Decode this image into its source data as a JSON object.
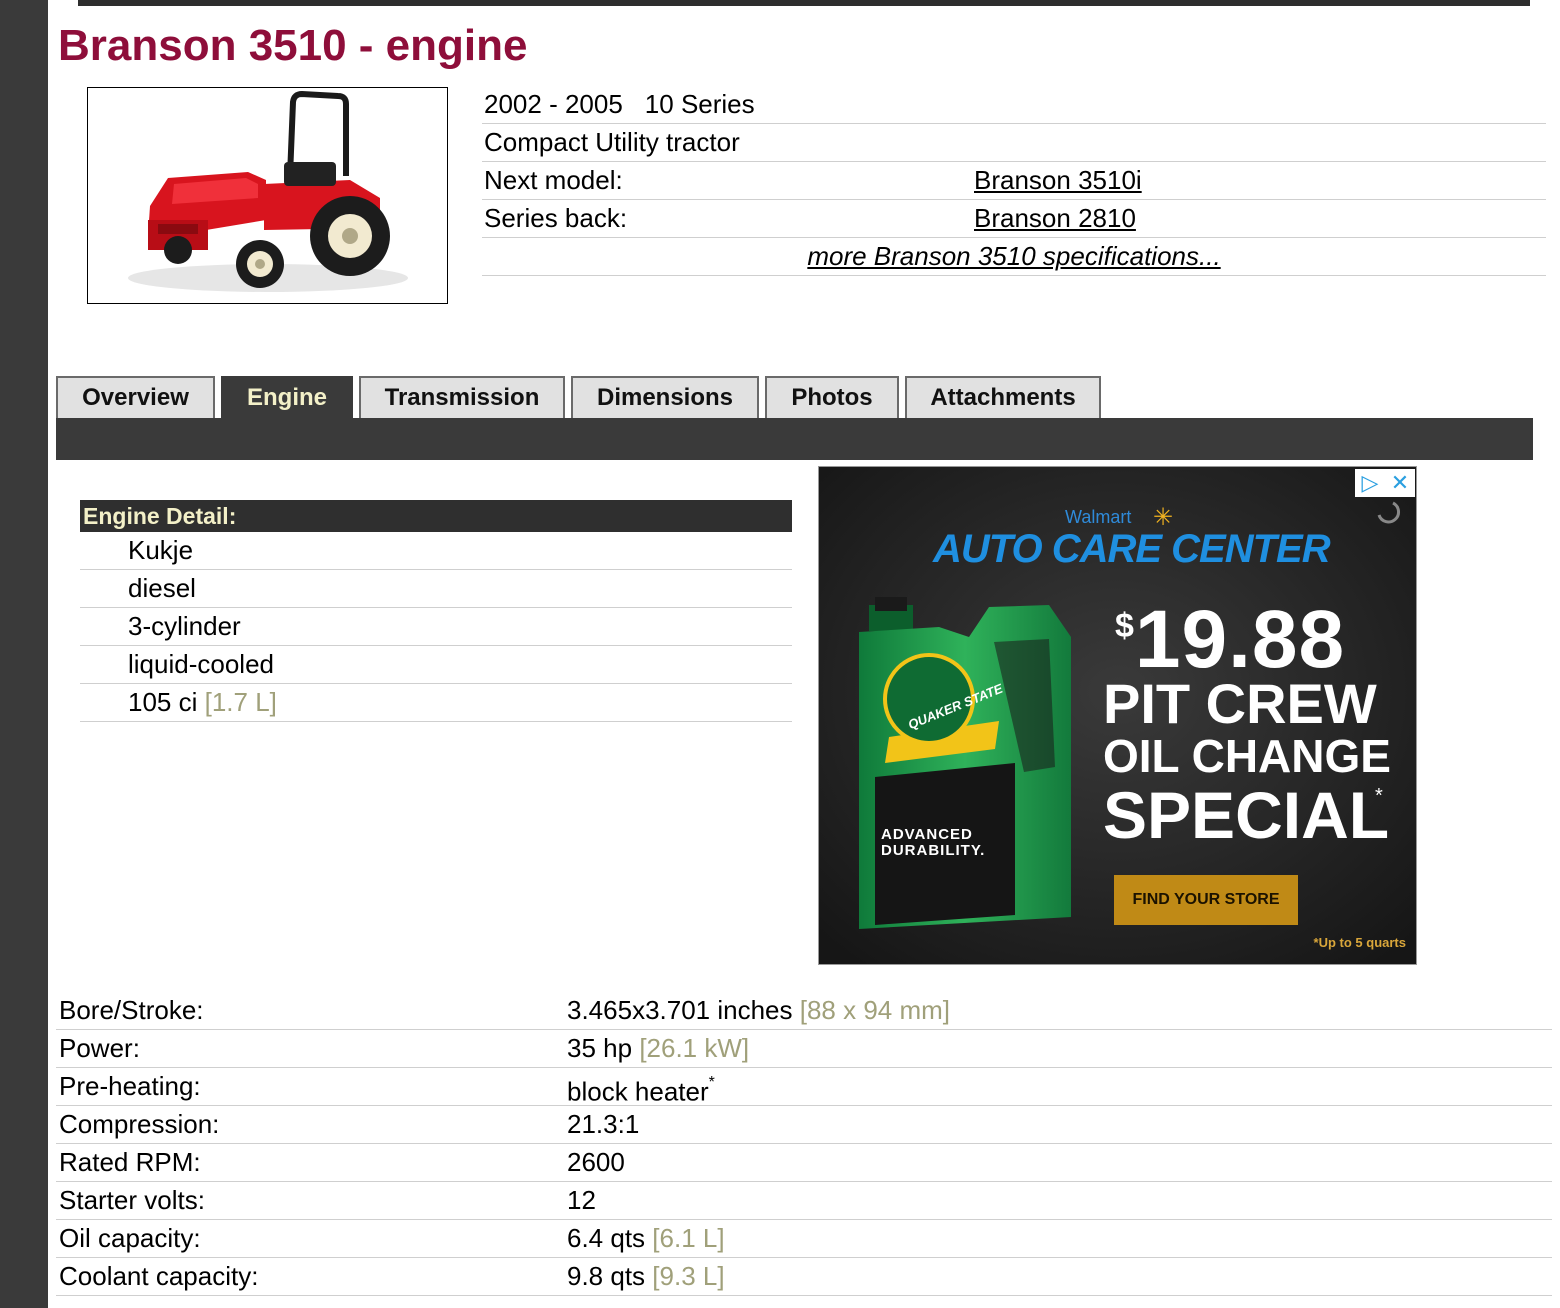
{
  "page": {
    "title": "Branson 3510 - engine"
  },
  "summary": {
    "years": "2002 - 2005",
    "series": "10 Series",
    "type": "Compact Utility tractor",
    "next_model_label": "Next model:",
    "next_model_value": "Branson 3510i",
    "series_back_label": "Series back:",
    "series_back_value": "Branson 2810",
    "more_link": "more Branson 3510 specifications..."
  },
  "tabs": [
    {
      "label": "Overview",
      "active": false
    },
    {
      "label": "Engine",
      "active": true
    },
    {
      "label": "Transmission",
      "active": false
    },
    {
      "label": "Dimensions",
      "active": false
    },
    {
      "label": "Photos",
      "active": false
    },
    {
      "label": "Attachments",
      "active": false
    }
  ],
  "engine_detail": {
    "heading": "Engine Detail:",
    "manufacturer": "Kukje",
    "fuel": "diesel",
    "cylinders": "3-cylinder",
    "cooling": "liquid-cooled",
    "displacement": "105 ci",
    "displacement_metric": "[1.7 L]"
  },
  "ad": {
    "brand": "Walmart",
    "headline": "AUTO CARE CENTER",
    "price_symbol": "$",
    "price": "19.88",
    "line1": "PIT CREW",
    "line2": "OIL CHANGE",
    "line3": "SPECIAL",
    "asterisk": "*",
    "cta": "FIND YOUR STORE",
    "disclaimer": "*Up to 5 quarts",
    "product_brand": "QUAKER STATE",
    "product_line1": "ADVANCED",
    "product_line2": "DURABILITY.",
    "adchoices_icon": "play-triangle-icon",
    "close_icon": "close-x-icon",
    "accent": "#1f8fe0",
    "cta_color": "#c08a16"
  },
  "specs": [
    {
      "label": "Bore/Stroke:",
      "value": "3.465x3.701 inches",
      "metric": "[88 x 94 mm]",
      "note": ""
    },
    {
      "label": "Power:",
      "value": "35 hp",
      "metric": "[26.1 kW]",
      "note": ""
    },
    {
      "label": "Pre-heating:",
      "value": "block heater",
      "metric": "",
      "note": "*"
    },
    {
      "label": "Compression:",
      "value": "21.3:1",
      "metric": "",
      "note": ""
    },
    {
      "label": "Rated RPM:",
      "value": "2600",
      "metric": "",
      "note": ""
    },
    {
      "label": "Starter volts:",
      "value": "12",
      "metric": "",
      "note": ""
    },
    {
      "label": "Oil capacity:",
      "value": "6.4 qts",
      "metric": "[6.1 L]",
      "note": ""
    },
    {
      "label": "Coolant capacity:",
      "value": "9.8 qts",
      "metric": "[9.3 L]",
      "note": ""
    }
  ],
  "colors": {
    "title": "#8e0e3a",
    "dark_bar": "#3a3a3a",
    "active_tab_text": "#f3f0c8",
    "metric_text": "#a0a07a"
  }
}
